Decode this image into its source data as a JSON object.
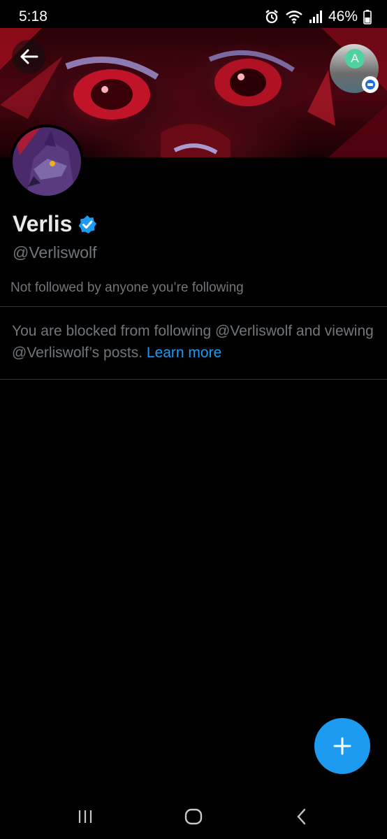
{
  "status_bar": {
    "time": "5:18",
    "battery": "46%",
    "icons": [
      "alarm-icon",
      "wifi-icon",
      "signal-icon",
      "battery-icon"
    ]
  },
  "header": {
    "back_icon": "arrow-left-icon",
    "account_initial": "A",
    "account_badge_icon": "messenger-icon"
  },
  "profile": {
    "name": "Verlis",
    "verified_icon": "verified-badge-icon",
    "handle": "@Verliswolf",
    "followers_note": "Not followed by anyone you’re following"
  },
  "blocked": {
    "message": "You are blocked from following @Verliswolf and viewing @Verliswolf’s posts.",
    "link": "Learn more"
  },
  "fab": {
    "icon": "plus-icon"
  },
  "nav": {
    "icons": [
      "recents-icon",
      "home-icon",
      "back-icon"
    ]
  },
  "colors": {
    "accent": "#1d9bf0",
    "muted": "#71767b",
    "text": "#e7e9ea",
    "divider": "#2f3336",
    "background": "#000000"
  }
}
